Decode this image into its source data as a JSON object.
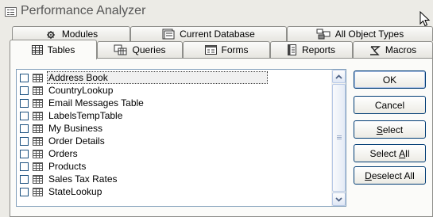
{
  "window": {
    "title": "Performance Analyzer"
  },
  "tabs_row1": [
    {
      "label": "Modules",
      "icon": "modules-icon"
    },
    {
      "label": "Current Database",
      "icon": "database-icon"
    },
    {
      "label": "All Object Types",
      "icon": "all-object-types-icon"
    }
  ],
  "tabs_row2": [
    {
      "label": "Tables",
      "icon": "table-icon",
      "active": true
    },
    {
      "label": "Queries",
      "icon": "query-icon"
    },
    {
      "label": "Forms",
      "icon": "form-icon"
    },
    {
      "label": "Reports",
      "icon": "report-icon"
    },
    {
      "label": "Macros",
      "icon": "macro-icon"
    }
  ],
  "list": {
    "items": [
      {
        "label": "Address Book",
        "checked": false,
        "selected": true
      },
      {
        "label": "CountryLookup",
        "checked": false
      },
      {
        "label": "Email Messages Table",
        "checked": false
      },
      {
        "label": "LabelsTempTable",
        "checked": false
      },
      {
        "label": "My Business",
        "checked": false
      },
      {
        "label": "Order Details",
        "checked": false
      },
      {
        "label": "Orders",
        "checked": false
      },
      {
        "label": "Products",
        "checked": false
      },
      {
        "label": "Sales Tax Rates",
        "checked": false
      },
      {
        "label": "StateLookup",
        "checked": false
      }
    ]
  },
  "buttons": {
    "ok": "OK",
    "cancel": "Cancel",
    "select": {
      "accel": "S",
      "rest": "elect"
    },
    "select_all": {
      "pre": "Select ",
      "accel": "A",
      "post": "ll"
    },
    "deselect_all": {
      "accel": "D",
      "rest": "eselect All"
    }
  },
  "colors": {
    "accent": "#003c74",
    "window_bg": "#ecebe6",
    "panel_bg": "#fbfbf9"
  }
}
